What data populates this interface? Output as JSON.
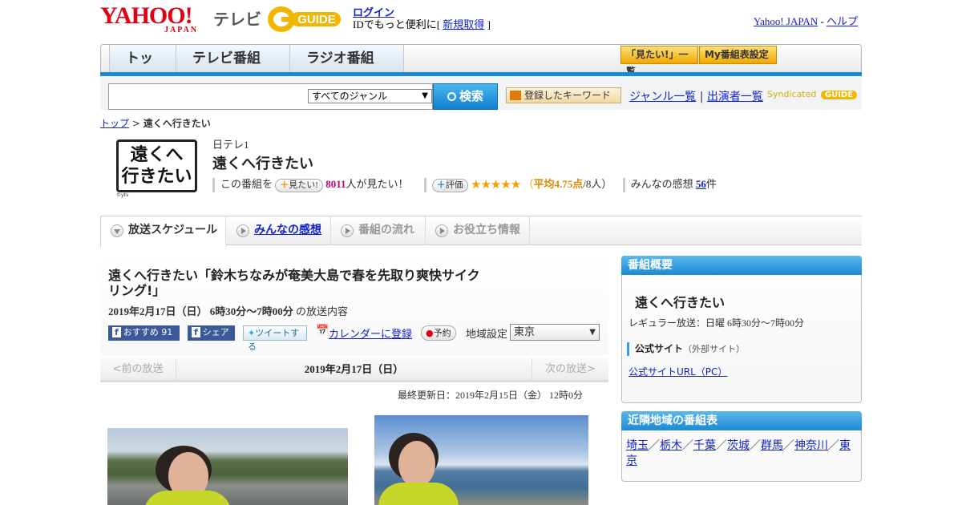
{
  "header": {
    "yahoo_logo": "YAHOO!",
    "japan_logo": "JAPAN",
    "tv_label": "テレビ",
    "gguide_logo": "GUIDE",
    "login": "ログイン",
    "login_sub_prefix": "IDでもっと便利に[",
    "signup": "新規取得",
    "login_sub_suffix": "]",
    "yahoo_japan": "Yahoo! JAPAN",
    "separator": "-",
    "help": "ヘルプ"
  },
  "nav": {
    "tabs": [
      "トップ",
      "テレビ番組表",
      "ラジオ番組表"
    ],
    "mitai_list": "「見たい!」一覧",
    "my_guide_settings": "My番組表設定"
  },
  "search": {
    "input_value": "",
    "genre_selected": "すべてのジャンル",
    "search_button": "検索",
    "keyword_button": "登録したキーワード",
    "genre_list": "ジャンル一覧",
    "link_sep": "|",
    "performer_list": "出演者一覧",
    "syndicated": "Syndicated"
  },
  "breadcrumb": {
    "top": "トップ",
    "sep": ">",
    "current": "遠くへ行きたい"
  },
  "program": {
    "logo_line1": "遠くへ",
    "logo_line2": "行きたい",
    "logo_credit": "©ytv",
    "channel": "日テレ1",
    "title": "遠くへ行きたい",
    "mitai_prefix": "この番組を",
    "mitai_button": "見たい!",
    "mitai_count": "8011",
    "mitai_suffix": "人が見たい！",
    "rating_button": "評価",
    "stars": "★★★★★",
    "rating_open": "（",
    "rating_avg": "平均4.75点",
    "rating_count": "/8人）",
    "reviews_label": "みんなの感想",
    "reviews_count": "56",
    "reviews_unit": "件",
    "rating_value": 4.75
  },
  "tabs": [
    "放送スケジュール",
    "みんなの感想",
    "番組の流れ",
    "お役立ち情報"
  ],
  "episode": {
    "title": "遠くへ行きたい「鈴木ちなみが奄美大島で春を先取り爽快サイクリング!」",
    "date_time": "2019年2月17日（日） 6時30分～7時00分",
    "date_suffix": "の放送内容",
    "recommend": "おすすめ",
    "recommend_count": "91",
    "share": "シェア",
    "tweet": "ツイートする",
    "calendar": "カレンダーに登録",
    "reserve": "予約",
    "region_label": "地域設定",
    "region_value": "東京"
  },
  "pager": {
    "prev": "<前の放送",
    "date": "2019年2月17日（日）",
    "next": "次の放送>"
  },
  "updated": "最終更新日：2019年2月15日（金） 12時0分",
  "sidebar": {
    "overview_header": "番組概要",
    "overview_title": "遠くへ行きたい",
    "regular": "レギュラー放送：日曜 6時30分～7時00分",
    "official_site": "公式サイト",
    "external": "（外部サイト）",
    "official_url": "公式サイトURL（PC）",
    "nearby_header": "近隣地域の番組表",
    "regions": [
      "埼玉",
      "栃木",
      "千葉",
      "茨城",
      "群馬",
      "神奈川",
      "東京"
    ],
    "region_sep": "／"
  },
  "colors": {
    "accent_blue": "#1a8ad0",
    "brand_red": "#e00012",
    "star": "#f0a000",
    "count_pink": "#cc0077"
  }
}
